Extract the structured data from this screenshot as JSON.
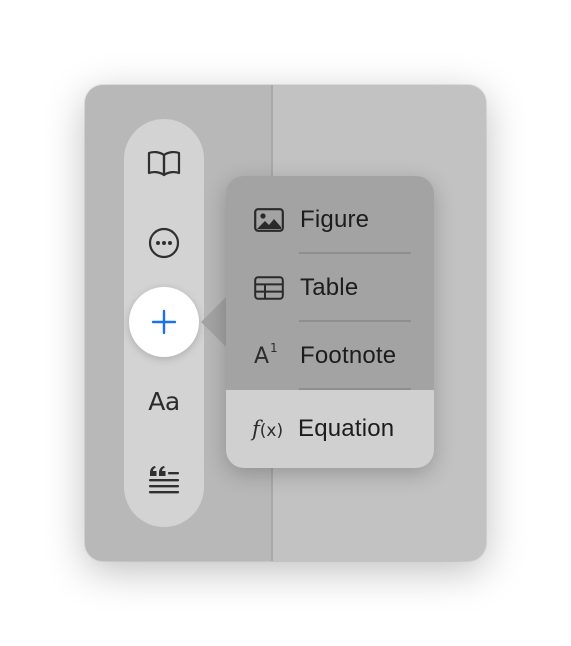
{
  "toolbar": {
    "format_label": "Aa"
  },
  "insert_menu": {
    "items": [
      {
        "label": "Figure",
        "icon": "photo-icon"
      },
      {
        "label": "Table",
        "icon": "table-icon"
      },
      {
        "label": "Footnote",
        "icon": "footnote-icon",
        "glyph": "A",
        "sup": "1"
      },
      {
        "label": "Equation",
        "icon": "function-icon",
        "glyph_f": "f",
        "glyph_x": "(x)"
      }
    ],
    "highlighted_index": 3
  },
  "colors": {
    "accent": "#1a73e8",
    "menu_background": "#a3a3a3",
    "highlight": "#d0d0d0"
  }
}
